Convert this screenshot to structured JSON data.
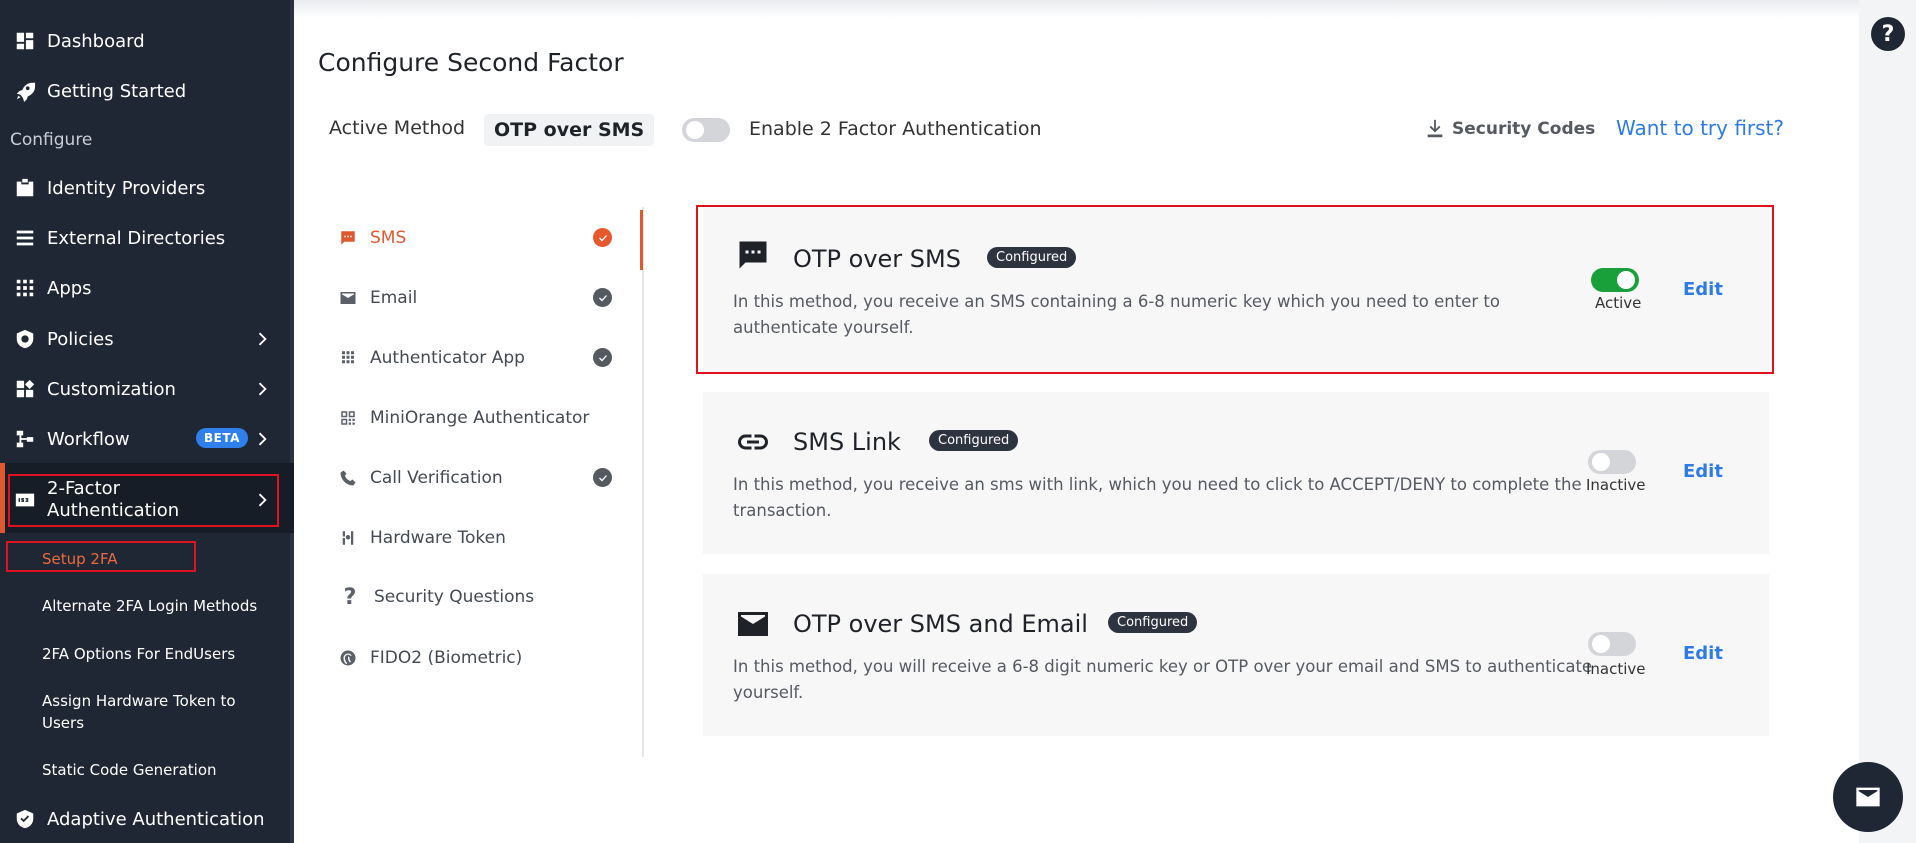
{
  "sidebar": {
    "items": [
      {
        "label": "Dashboard",
        "icon": "dashboard-icon"
      },
      {
        "label": "Getting Started",
        "icon": "rocket-icon"
      },
      {
        "label": "Identity Providers",
        "icon": "id-badge-icon"
      },
      {
        "label": "External Directories",
        "icon": "list-icon"
      },
      {
        "label": "Apps",
        "icon": "apps-grid-icon"
      },
      {
        "label": "Policies",
        "icon": "shield-icon"
      },
      {
        "label": "Customization",
        "icon": "customize-icon"
      },
      {
        "label": "Workflow",
        "icon": "workflow-icon"
      },
      {
        "label": "2-Factor Authentication",
        "icon": "two-factor-icon"
      },
      {
        "label": "Adaptive Authentication",
        "icon": "shield-check-icon"
      }
    ],
    "section_label": "Configure",
    "beta_badge": "BETA",
    "two_factor_line1": "2-Factor",
    "two_factor_line2": "Authentication",
    "subitems": [
      "Setup 2FA",
      "Alternate 2FA Login Methods",
      "2FA Options For EndUsers",
      "Assign Hardware Token to Users",
      "Static Code Generation"
    ],
    "sub_assign_line1": "Assign Hardware Token to",
    "sub_assign_line2": "Users"
  },
  "header": {
    "title": "Configure Second Factor",
    "active_method_label": "Active Method",
    "active_method_value": "OTP over SMS",
    "enable_2fa_label": "Enable 2 Factor Authentication",
    "enable_2fa_on": false,
    "security_codes": "Security Codes",
    "try_link": "Want to try first?"
  },
  "methods": [
    {
      "label": "SMS",
      "icon": "sms-icon",
      "configured": true,
      "current": true
    },
    {
      "label": "Email",
      "icon": "email-icon",
      "configured": true
    },
    {
      "label": "Authenticator App",
      "icon": "keypad-icon",
      "configured": true
    },
    {
      "label": "MiniOrange Authenticator",
      "icon": "qr-icon",
      "configured": false
    },
    {
      "label": "Call Verification",
      "icon": "phone-icon",
      "configured": true
    },
    {
      "label": "Hardware Token",
      "icon": "token-icon",
      "configured": false
    },
    {
      "label": "Security Questions",
      "icon": "question-icon",
      "configured": false
    },
    {
      "label": "FIDO2 (Biometric)",
      "icon": "fingerprint-icon",
      "configured": false
    }
  ],
  "cards": [
    {
      "title": "OTP over SMS",
      "icon": "sms-bubble-icon",
      "badge": "Configured",
      "desc_line1": "In this method, you receive an SMS containing a 6-8 numeric key which you need to enter to",
      "desc_line2": "authenticate yourself.",
      "status": "Active",
      "enabled": true,
      "edit": "Edit"
    },
    {
      "title": "SMS Link",
      "icon": "link-icon",
      "badge": "Configured",
      "desc_line1": "In this method, you receive an sms with link, which you need to click to ACCEPT/DENY to complete the",
      "desc_line2": "transaction.",
      "status": "Inactive",
      "enabled": false,
      "edit": "Edit"
    },
    {
      "title": "OTP over SMS and Email",
      "icon": "envelope-icon",
      "badge": "Configured",
      "desc_line1": "In this method, you will receive a 6-8 digit numeric key or OTP over your email and SMS to authenticate",
      "desc_line2": "yourself.",
      "status": "Inactive",
      "enabled": false,
      "edit": "Edit"
    }
  ],
  "help": {
    "glyph": "?"
  },
  "colors": {
    "sidebar_bg": "#1e2733",
    "accent_orange": "#e0582f",
    "highlight_red": "#e0121e",
    "link_blue": "#2f7be5",
    "toggle_on": "#1aa03a"
  }
}
